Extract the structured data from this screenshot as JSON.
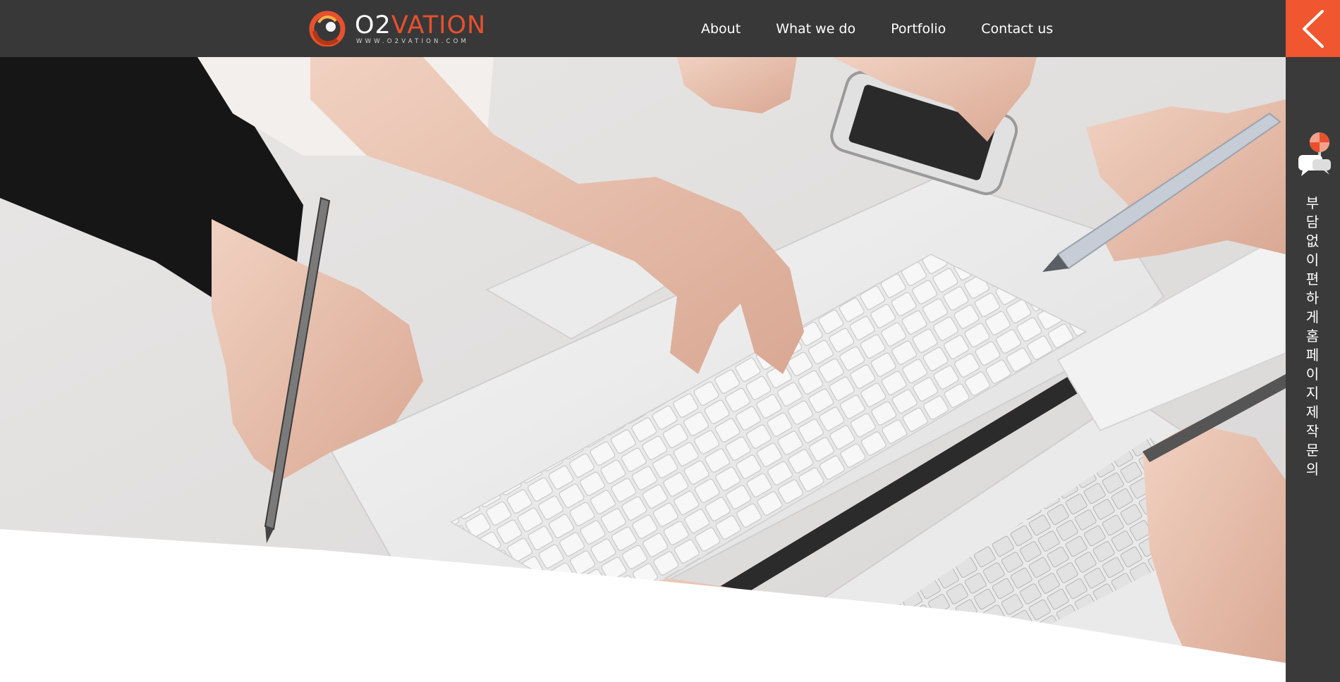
{
  "brand": {
    "name_prefix": "O2",
    "name_suffix": "VATION",
    "url": "WWW.O2VATION.COM"
  },
  "nav": {
    "items": [
      {
        "label": "About"
      },
      {
        "label": "What we do"
      },
      {
        "label": "Portfolio"
      },
      {
        "label": "Contact us"
      }
    ]
  },
  "sidebar": {
    "toggle_icon": "chevron-left-icon",
    "inquiry_icon": "chat-lollipop-icon",
    "inquiry_text": "부담없이 편하게 홈페이지제작 문의"
  },
  "hero": {
    "image": "hands-typing-on-laptop-photo"
  },
  "colors": {
    "header_bg": "#383838",
    "accent": "#f0562f",
    "sidebar_bg": "#3a3a3a"
  }
}
